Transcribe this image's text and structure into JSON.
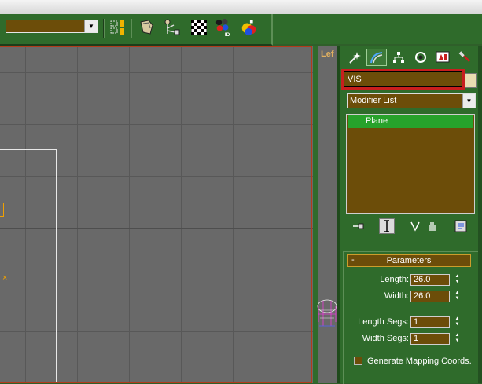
{
  "toolbar": {
    "selection_set_value": "",
    "icons": [
      "align-icon",
      "named-selection-icon",
      "shield-icon",
      "schematic-icon",
      "checker-icon",
      "material-id-icon",
      "render-teapot-icon"
    ]
  },
  "viewport": {
    "side_label": "Lef"
  },
  "command_panel": {
    "tabs": [
      "create-tab",
      "modify-tab",
      "hierarchy-tab",
      "motion-tab",
      "display-tab",
      "utilities-tab"
    ],
    "object_name": "VIS",
    "modifier_list": "Modifier List",
    "stack_items": [
      "Plane"
    ]
  },
  "parameters": {
    "title": "Parameters",
    "collapse_symbol": "-",
    "length_label": "Length:",
    "length_value": "26.0",
    "width_label": "Width:",
    "width_value": "26.0",
    "length_segs_label": "Length Segs:",
    "length_segs_value": "1",
    "width_segs_label": "Width Segs:",
    "width_segs_value": "1",
    "generate_mapping_label": "Generate Mapping Coords."
  },
  "colors": {
    "panel_bg": "#2f6b2b",
    "field_bg": "#6c4d09",
    "highlight": "#c81e1e",
    "stack_selected": "#27a22b",
    "viewport": "#696969"
  }
}
